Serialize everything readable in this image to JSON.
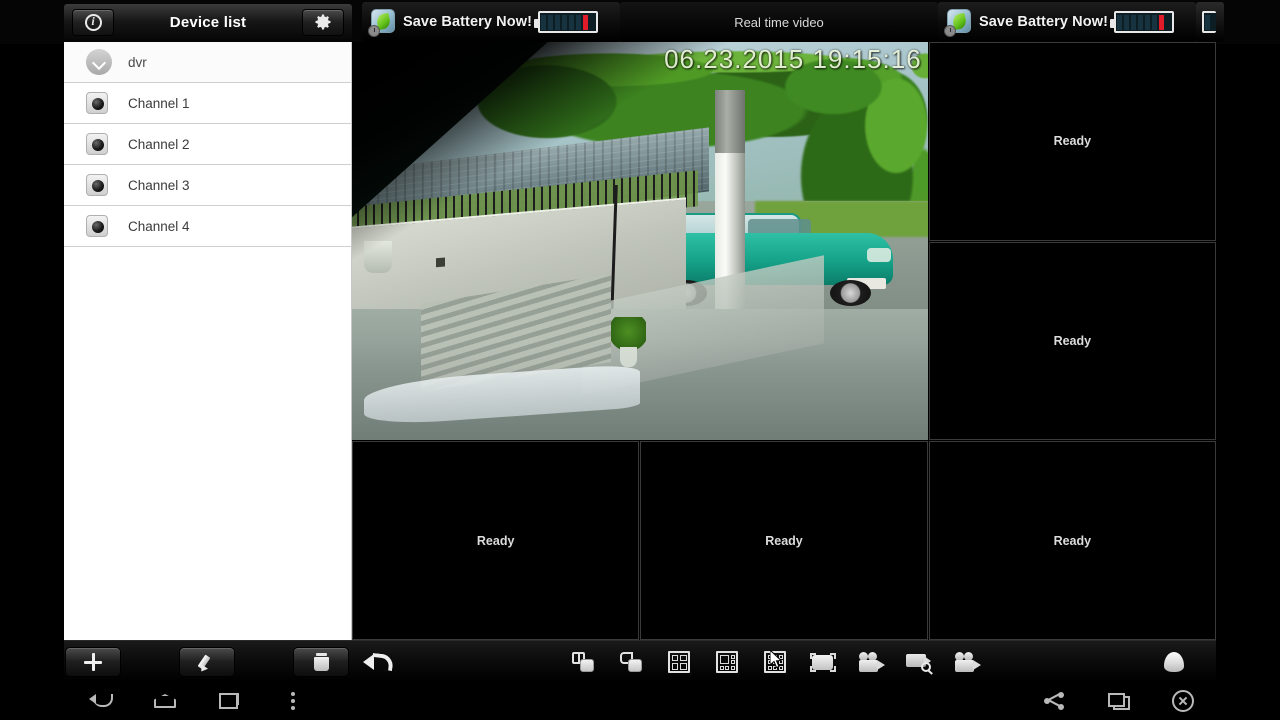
{
  "statusbar": {
    "notifications": [
      {
        "title": "Save Battery Now!",
        "icon": "battery-saver-icon"
      },
      {
        "title": "Real time video",
        "icon": ""
      },
      {
        "title": "Save Battery Now!",
        "icon": "battery-saver-icon"
      }
    ]
  },
  "titlebar": {
    "info_icon": "info-icon",
    "title": "Device list",
    "settings_icon": "gear-icon"
  },
  "sidebar": {
    "device": {
      "label": "dvr",
      "icon": "chevron-down-icon"
    },
    "channels": [
      {
        "label": "Channel 1",
        "icon": "camera-icon"
      },
      {
        "label": "Channel 2",
        "icon": "camera-icon"
      },
      {
        "label": "Channel 3",
        "icon": "camera-icon"
      },
      {
        "label": "Channel 4",
        "icon": "camera-icon"
      }
    ]
  },
  "video": {
    "live_timestamp": "06.23.2015 19:15:16",
    "ready_label": "Ready",
    "cells": [
      {
        "state": "live",
        "label": ""
      },
      {
        "state": "ready",
        "label": "Ready"
      },
      {
        "state": "ready",
        "label": "Ready"
      },
      {
        "state": "ready",
        "label": "Ready"
      },
      {
        "state": "ready",
        "label": "Ready"
      },
      {
        "state": "ready",
        "label": "Ready"
      }
    ]
  },
  "toolbar": {
    "add": "add-device-button",
    "edit": "edit-device-button",
    "delete": "delete-device-button",
    "undo": "back-button",
    "layout_pip": "picture-in-picture-button",
    "layout_pip_round": "overlay-layout-button",
    "layout_2x2": "layout-2x2-button",
    "layout_1plus5": "layout-1plus5-button",
    "layout_3x3": "layout-3x3-button",
    "fullscreen": "fullscreen-button",
    "record": "record-button",
    "snapshot": "snapshot-search-button",
    "playback": "playback-button",
    "ptz": "ptz-button"
  },
  "navbar": {
    "back": "back-icon",
    "home": "home-icon",
    "recents": "recents-icon",
    "menu": "overflow-menu-icon",
    "share": "share-icon",
    "window": "window-icon",
    "close": "close-icon"
  },
  "colors": {
    "accent_red": "#e01b2a",
    "battery_dark": "#17333f",
    "sidebar_bg": "#ffffff",
    "toolbar_bg": "#0c0c0c"
  }
}
